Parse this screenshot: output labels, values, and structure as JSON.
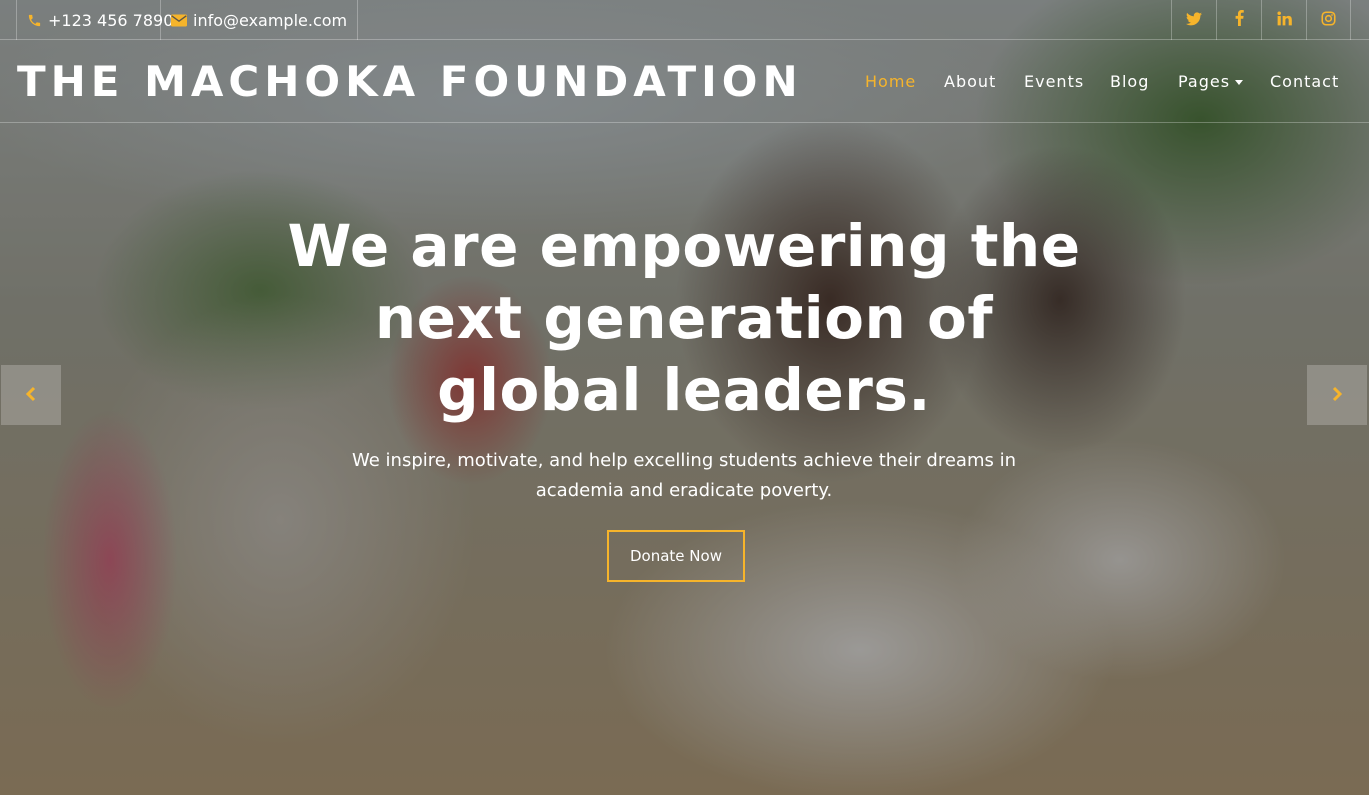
{
  "topbar": {
    "phone": "+123 456 7890",
    "email": "info@example.com",
    "social_icons": [
      "twitter-icon",
      "facebook-icon",
      "linkedin-icon",
      "instagram-icon"
    ]
  },
  "navbar": {
    "brand": "THE MACHOKA FOUNDATION",
    "links": [
      {
        "label": "Home",
        "active": true
      },
      {
        "label": "About"
      },
      {
        "label": "Events"
      },
      {
        "label": "Blog"
      },
      {
        "label": "Pages",
        "dropdown": true
      },
      {
        "label": "Contact"
      }
    ]
  },
  "hero": {
    "headline_line1": "We are empowering the",
    "headline_line2": "next generation of",
    "headline_line3": "global leaders.",
    "subtext": "We inspire, motivate, and help excelling students achieve their dreams in academia and eradicate poverty.",
    "cta_label": "Donate Now",
    "prev_icon": "chevron-left-icon",
    "next_icon": "chevron-right-icon"
  },
  "colors": {
    "accent": "#f6b42b",
    "text": "#ffffff"
  }
}
